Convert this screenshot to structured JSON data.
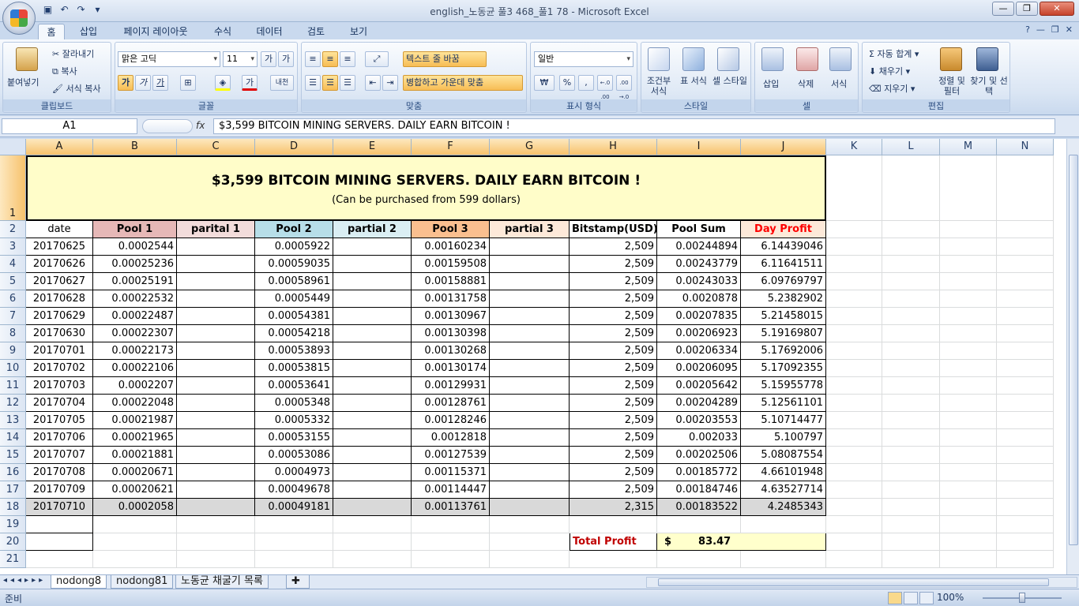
{
  "window": {
    "title": "english_노동균 풀3 468_풀1 78 - Microsoft Excel"
  },
  "ribbon_tabs": [
    "홈",
    "삽입",
    "페이지 레이아웃",
    "수식",
    "데이터",
    "검토",
    "보기"
  ],
  "ribbon": {
    "clipboard": {
      "paste": "붙여넣기",
      "cut": "잘라내기",
      "copy": "복사",
      "format_painter": "서식 복사",
      "label": "클립보드"
    },
    "font": {
      "name": "맑은 고딕",
      "size": "11",
      "label": "글꼴",
      "bold": "가",
      "italic": "가",
      "underline": "가",
      "font_color_btn": "가",
      "phonetic": "내천"
    },
    "alignment": {
      "wrap": "텍스트 줄 바꿈",
      "merge": "병합하고 가운데 맞춤",
      "label": "맞춤"
    },
    "number": {
      "format": "일반",
      "currency": "₩",
      "percent": "%",
      "comma": ",",
      "inc_decimal": "←.0 .00",
      "dec_decimal": ".00 →.0",
      "label": "표시 형식"
    },
    "styles": {
      "conditional": "조건부 서식",
      "table": "표 서식",
      "cell": "셀 스타일",
      "label": "스타일"
    },
    "cells": {
      "insert": "삽입",
      "delete": "삭제",
      "format": "서식",
      "label": "셀"
    },
    "editing": {
      "autosum": "자동 합계",
      "fill": "채우기",
      "clear": "지우기",
      "sort": "정렬 및 필터",
      "find": "찾기 및 선택",
      "label": "편집"
    }
  },
  "formula_bar": {
    "name_box": "A1",
    "fx": "fx",
    "content": "$3,599 BITCOIN MINING SERVERS. DAILY EARN BITCOIN !"
  },
  "columns": [
    "A",
    "B",
    "C",
    "D",
    "E",
    "F",
    "G",
    "H",
    "I",
    "J",
    "K",
    "L",
    "M",
    "N"
  ],
  "rows": [
    "1",
    "2",
    "3",
    "4",
    "5",
    "6",
    "7",
    "8",
    "9",
    "10",
    "11",
    "12",
    "13",
    "14",
    "15",
    "16",
    "17",
    "18",
    "19",
    "20",
    "21"
  ],
  "banner": {
    "title": "$3,599 BITCOIN MINING SERVERS. DAILY EARN BITCOIN !",
    "subtitle": "(Can be purchased from 599 dollars)"
  },
  "table": {
    "headers": [
      "date",
      "Pool 1",
      "parital 1",
      "Pool 2",
      "partial 2",
      "Pool 3",
      "partial 3",
      "Bitstamp(USD)",
      "Pool Sum",
      "Day Profit"
    ],
    "rows": [
      [
        "20170625",
        "0.0002544",
        "",
        "0.0005922",
        "",
        "0.00160234",
        "",
        "2,509",
        "0.00244894",
        "6.14439046"
      ],
      [
        "20170626",
        "0.00025236",
        "",
        "0.00059035",
        "",
        "0.00159508",
        "",
        "2,509",
        "0.00243779",
        "6.11641511"
      ],
      [
        "20170627",
        "0.00025191",
        "",
        "0.00058961",
        "",
        "0.00158881",
        "",
        "2,509",
        "0.00243033",
        "6.09769797"
      ],
      [
        "20170628",
        "0.00022532",
        "",
        "0.0005449",
        "",
        "0.00131758",
        "",
        "2,509",
        "0.0020878",
        "5.2382902"
      ],
      [
        "20170629",
        "0.00022487",
        "",
        "0.00054381",
        "",
        "0.00130967",
        "",
        "2,509",
        "0.00207835",
        "5.21458015"
      ],
      [
        "20170630",
        "0.00022307",
        "",
        "0.00054218",
        "",
        "0.00130398",
        "",
        "2,509",
        "0.00206923",
        "5.19169807"
      ],
      [
        "20170701",
        "0.00022173",
        "",
        "0.00053893",
        "",
        "0.00130268",
        "",
        "2,509",
        "0.00206334",
        "5.17692006"
      ],
      [
        "20170702",
        "0.00022106",
        "",
        "0.00053815",
        "",
        "0.00130174",
        "",
        "2,509",
        "0.00206095",
        "5.17092355"
      ],
      [
        "20170703",
        "0.0002207",
        "",
        "0.00053641",
        "",
        "0.00129931",
        "",
        "2,509",
        "0.00205642",
        "5.15955778"
      ],
      [
        "20170704",
        "0.00022048",
        "",
        "0.0005348",
        "",
        "0.00128761",
        "",
        "2,509",
        "0.00204289",
        "5.12561101"
      ],
      [
        "20170705",
        "0.00021987",
        "",
        "0.0005332",
        "",
        "0.00128246",
        "",
        "2,509",
        "0.00203553",
        "5.10714477"
      ],
      [
        "20170706",
        "0.00021965",
        "",
        "0.00053155",
        "",
        "0.0012818",
        "",
        "2,509",
        "0.002033",
        "5.100797"
      ],
      [
        "20170707",
        "0.00021881",
        "",
        "0.00053086",
        "",
        "0.00127539",
        "",
        "2,509",
        "0.00202506",
        "5.08087554"
      ],
      [
        "20170708",
        "0.00020671",
        "",
        "0.0004973",
        "",
        "0.00115371",
        "",
        "2,509",
        "0.00185772",
        "4.66101948"
      ],
      [
        "20170709",
        "0.00020621",
        "",
        "0.00049678",
        "",
        "0.00114447",
        "",
        "2,509",
        "0.00184746",
        "4.63527714"
      ],
      [
        "20170710",
        "0.0002058",
        "",
        "0.00049181",
        "",
        "0.00113761",
        "",
        "2,315",
        "0.00183522",
        "4.2485343"
      ]
    ]
  },
  "total": {
    "label": "Total Profit",
    "currency": "$",
    "value": "83.47"
  },
  "sheet_tabs": [
    "nodong8",
    "nodong81",
    "노동균 채굴기 목록"
  ],
  "status": {
    "mode": "준비",
    "zoom": "100%"
  },
  "colors": {
    "pool1_header": "#e6b8b7",
    "partial1_header": "#f2dcdb",
    "pool2_header": "#b7dee8",
    "partial2_header": "#daeef3",
    "pool3_header": "#fabf8f",
    "partial3_header": "#fde9d9",
    "day_profit_header": "#fde9d9",
    "day_profit_text": "#ff0000",
    "banner_bg": "#fffdc9",
    "total_bg": "#ffffcc",
    "total_label": "#c00000",
    "last_row_bg": "#d9d9d9"
  }
}
